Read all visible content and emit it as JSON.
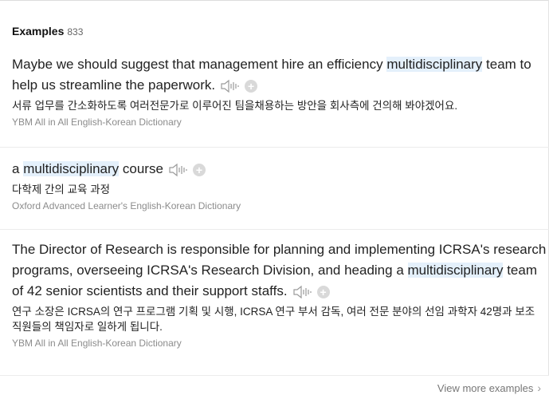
{
  "header": {
    "title": "Examples",
    "count": "833"
  },
  "examples": [
    {
      "en_before": "Maybe we should suggest that management hire an efficiency ",
      "en_highlight": "multidisciplinary",
      "en_after": " team to help us streamline the paperwork.",
      "ko": "서류 업무를 간소화하도록 여러전문가로 이루어진 팀을채용하는 방안을 회사측에 건의해 봐야겠어요.",
      "source": "YBM All in All English-Korean Dictionary"
    },
    {
      "en_before": "a ",
      "en_highlight": "multidisciplinary",
      "en_after": " course",
      "ko": "다학제 간의 교육 과정",
      "source": "Oxford Advanced Learner's English-Korean Dictionary"
    },
    {
      "en_before": "The Director of Research is responsible for planning and implementing ICRSA's research programs, overseeing ICRSA's Research Division, and heading a ",
      "en_highlight": "multidisciplinary",
      "en_after": " team of 42 senior scientists and their support staffs.",
      "ko": "연구 소장은 ICRSA의 연구 프로그램 기획 및 시행, ICRSA 연구 부서 감독, 여러 전문 분야의 선임 과학자 42명과 보조 직원들의 책임자로 일하게 됩니다.",
      "source": "YBM All in All English-Korean Dictionary"
    }
  ],
  "footer": {
    "more_label": "View more examples"
  },
  "icons": {
    "speaker": "speaker-icon",
    "add": "plus-icon",
    "more": "chevron-right-icon"
  },
  "colors": {
    "highlight": "#e4f0fb",
    "source_text": "#8c8c8c"
  }
}
